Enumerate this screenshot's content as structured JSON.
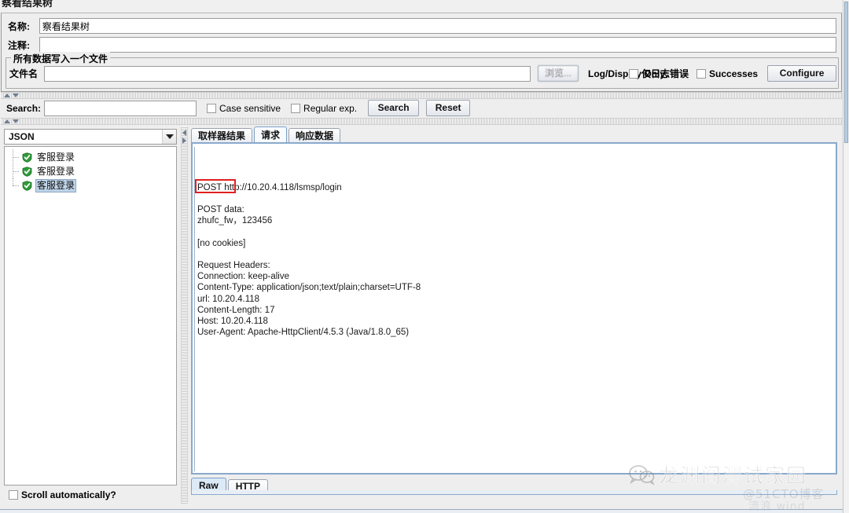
{
  "window": {
    "title": "察看结果树"
  },
  "config": {
    "name_label": "名称:",
    "name_value": "察看结果树",
    "comment_label": "注释:",
    "comment_value": "",
    "group_title": "所有数据写入一个文件",
    "filename_label": "文件名",
    "filename_value": "",
    "browse_button": "浏览...",
    "log_display_only_label": "Log/Display Only:",
    "errors_only_checkbox": "仅日志错误",
    "errors_only_checked": false,
    "successes_checkbox": "Successes",
    "successes_checked": false,
    "configure_button": "Configure"
  },
  "search": {
    "label": "Search:",
    "value": "",
    "case_sensitive_label": "Case sensitive",
    "case_sensitive_checked": false,
    "regular_exp_label": "Regular exp.",
    "regular_exp_checked": false,
    "search_button": "Search",
    "reset_button": "Reset"
  },
  "left_panel": {
    "renderer_selected": "JSON",
    "renderer_options": [
      "JSON"
    ],
    "tree_items": [
      {
        "label": "客服登录",
        "status": "success",
        "selected": false
      },
      {
        "label": "客服登录",
        "status": "success",
        "selected": false
      },
      {
        "label": "客服登录",
        "status": "success",
        "selected": true
      }
    ],
    "scroll_automatically_label": "Scroll automatically?",
    "scroll_automatically_checked": false
  },
  "right_panel": {
    "tabs": [
      {
        "label": "取样器结果",
        "active": false
      },
      {
        "label": "请求",
        "active": true
      },
      {
        "label": "响应数据",
        "active": false
      }
    ],
    "content_lines": [
      "POST http://10.20.4.118/lsmsp/login",
      "",
      "POST data:",
      "zhufc_fw，123456",
      "",
      "[no cookies]",
      "",
      "Request Headers:",
      "Connection: keep-alive",
      "Content-Type: application/json;text/plain;charset=UTF-8",
      "url: 10.20.4.118",
      "Content-Length: 17",
      "Host: 10.20.4.118",
      "User-Agent: Apache-HttpClient/4.5.3 (Java/1.8.0_65)"
    ],
    "highlight": {
      "text": "zhufc_fw，",
      "color": "#e02020"
    },
    "bottom_tabs": [
      {
        "label": "Raw",
        "active": true
      },
      {
        "label": "HTTP",
        "active": false
      }
    ]
  },
  "watermark": {
    "main": "龙渊阁测试家园",
    "sub": "@51CTO博客",
    "sub2": "流浪 wind",
    "icon": "wechat-icon"
  },
  "colors": {
    "accent": "#8aa9cc",
    "highlight": "#e02020",
    "selection": "#bfd4e8",
    "panel": "#eeeeee"
  }
}
